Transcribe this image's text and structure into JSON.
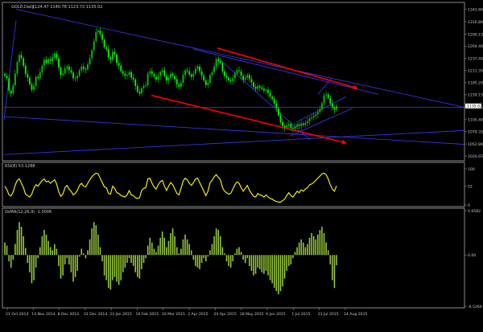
{
  "colors": {
    "background": "#000000",
    "frame": "#8a8a8a",
    "text": "#c8c8c8",
    "bull_candle": "#00cc00",
    "bear_candle": "#00ff00",
    "channel_lines": "#ff0000",
    "trend_lines": "#3a3aff",
    "rsi_line": "#ffff00",
    "osma_bars": "#9acd32",
    "price_line": "#b0b0b0"
  },
  "chart_data": [
    {
      "type": "candlestick",
      "title": "GOLD,Daily",
      "ohlc_text": "1124.47 1140.78 1123.72 1135.02",
      "y_ticks": [
        "1343.80",
        "1316.80",
        "1290.15",
        "1264.40",
        "1237.40",
        "1211.35",
        "1185.20",
        "1159.15",
        "1132.75",
        "1105.40",
        "1079.35",
        "1052.80",
        "1026.65"
      ],
      "ylim": [
        1020,
        1350
      ],
      "last_price": 1135.02,
      "closes": [
        1200,
        1195,
        1168,
        1162,
        1180,
        1205,
        1230,
        1245,
        1238,
        1222,
        1204,
        1196,
        1182,
        1170,
        1178,
        1198,
        1195,
        1208,
        1222,
        1235,
        1228,
        1236,
        1232,
        1240,
        1248,
        1238,
        1218,
        1202,
        1205,
        1216,
        1220,
        1212,
        1207,
        1195,
        1195,
        1200,
        1212,
        1220,
        1215,
        1214,
        1225,
        1238,
        1255,
        1275,
        1295,
        1298,
        1290,
        1278,
        1262,
        1258,
        1240,
        1235,
        1252,
        1246,
        1228,
        1222,
        1210,
        1205,
        1200,
        1202,
        1208,
        1196,
        1192,
        1178,
        1166,
        1162,
        1173,
        1178,
        1180,
        1205,
        1210,
        1204,
        1198,
        1192,
        1200,
        1208,
        1212,
        1200,
        1190,
        1196,
        1204,
        1200,
        1193,
        1182,
        1176,
        1185,
        1202,
        1212,
        1210,
        1203,
        1198,
        1205,
        1215,
        1220,
        1210,
        1201,
        1190,
        1180,
        1185,
        1202,
        1208,
        1220,
        1236,
        1232,
        1228,
        1210,
        1200,
        1196,
        1190,
        1188,
        1195,
        1205,
        1212,
        1210,
        1200,
        1192,
        1196,
        1202,
        1193,
        1186,
        1176,
        1172,
        1178,
        1175,
        1172,
        1168,
        1170,
        1163,
        1155,
        1150,
        1140,
        1130,
        1115,
        1100,
        1092,
        1088,
        1093,
        1096,
        1088,
        1086,
        1090,
        1095,
        1092,
        1097,
        1094,
        1098,
        1102,
        1108,
        1110,
        1113,
        1117,
        1122,
        1128,
        1141,
        1158,
        1160,
        1152,
        1140,
        1132,
        1127,
        1135
      ]
    },
    {
      "type": "line",
      "title": "RSI(8) 53.1288",
      "y_ticks": [
        "100",
        "52",
        "0"
      ],
      "ylim": [
        0,
        100
      ],
      "values": [
        52,
        42,
        28,
        25,
        36,
        55,
        68,
        72,
        60,
        48,
        30,
        26,
        22,
        30,
        46,
        56,
        52,
        60,
        68,
        72,
        64,
        66,
        60,
        65,
        70,
        58,
        36,
        24,
        30,
        48,
        54,
        44,
        38,
        28,
        32,
        40,
        54,
        60,
        52,
        50,
        60,
        70,
        78,
        84,
        88,
        86,
        74,
        62,
        50,
        48,
        32,
        30,
        52,
        46,
        34,
        32,
        26,
        24,
        22,
        28,
        40,
        28,
        26,
        20,
        18,
        20,
        40,
        46,
        48,
        72,
        74,
        60,
        50,
        44,
        56,
        64,
        68,
        52,
        40,
        52,
        62,
        56,
        44,
        32,
        28,
        46,
        66,
        74,
        70,
        60,
        54,
        62,
        72,
        74,
        62,
        50,
        38,
        26,
        38,
        62,
        68,
        78,
        84,
        76,
        70,
        48,
        38,
        34,
        30,
        32,
        44,
        56,
        64,
        60,
        48,
        38,
        46,
        54,
        40,
        32,
        24,
        22,
        32,
        28,
        26,
        22,
        28,
        22,
        18,
        16,
        12,
        10,
        8,
        8,
        12,
        16,
        26,
        34,
        26,
        22,
        30,
        38,
        34,
        42,
        38,
        44,
        48,
        56,
        58,
        62,
        68,
        74,
        80,
        86,
        88,
        84,
        72,
        56,
        44,
        38,
        53
      ]
    },
    {
      "type": "bar",
      "title": "OsMA(12,26,9) -1.3006",
      "y_ticks": [
        "5.6582",
        "0.00",
        "-6.5269"
      ],
      "ylim": [
        -6.5269,
        5.6582
      ],
      "x_ticks": [
        "21 Oct 2014",
        "14 Nov 2014",
        "8 Dec 2014",
        "31 Dec 2014",
        "23 Jan 2015",
        "16 Feb 2015",
        "10 Mar 2015",
        "2 Apr 2015",
        "24 Apr 2015",
        "18 May 2015",
        "9 Jun 2015",
        "1 Jul 2015",
        "23 Jul 2015",
        "14 Aug 2015"
      ],
      "values": [
        1.6,
        1.2,
        -0.8,
        -1.6,
        -0.6,
        1.4,
        3.2,
        4.2,
        3.6,
        2.4,
        0.9,
        -1.0,
        -2.2,
        -3.6,
        -3.2,
        -1.6,
        -0.4,
        1.0,
        2.4,
        3.2,
        2.6,
        1.8,
        1.0,
        0.6,
        1.4,
        0.8,
        -1.4,
        -3.0,
        -2.6,
        -1.2,
        -0.4,
        -1.2,
        -2.2,
        -3.4,
        -2.8,
        -2.0,
        -0.2,
        0.8,
        0.2,
        -0.4,
        0.6,
        2.0,
        3.4,
        4.2,
        3.8,
        2.6,
        1.0,
        -0.8,
        -2.6,
        -3.2,
        -4.2,
        -4.4,
        -3.2,
        -2.8,
        -3.4,
        -3.8,
        -3.2,
        -2.2,
        -1.6,
        -1.0,
        -0.4,
        -1.0,
        -1.4,
        -2.2,
        -2.8,
        -3.0,
        -1.8,
        -1.0,
        -0.4,
        1.2,
        2.2,
        1.6,
        0.8,
        0.4,
        1.2,
        2.2,
        3.0,
        2.2,
        1.0,
        1.8,
        2.8,
        3.4,
        2.4,
        1.0,
        0.2,
        0.8,
        2.0,
        2.6,
        2.0,
        1.4,
        0.6,
        -0.6,
        -1.4,
        -1.6,
        -1.8,
        -1.0,
        -0.4,
        -0.8,
        -0.2,
        0.6,
        1.4,
        2.4,
        3.4,
        3.2,
        2.4,
        1.0,
        0.2,
        -0.8,
        -1.4,
        -1.6,
        -0.8,
        0.2,
        0.8,
        1.0,
        0.4,
        -0.6,
        -1.0,
        -0.4,
        -1.4,
        -2.0,
        -2.6,
        -2.4,
        -1.6,
        -1.8,
        -2.2,
        -2.4,
        -2.0,
        -2.6,
        -3.2,
        -3.6,
        -4.2,
        -4.6,
        -5.0,
        -4.6,
        -4.0,
        -3.0,
        -2.0,
        -1.4,
        -1.2,
        -0.4,
        0.4,
        1.0,
        1.6,
        2.0,
        1.6,
        1.0,
        1.4,
        2.2,
        2.8,
        2.4,
        2.0,
        2.6,
        3.2,
        3.6,
        2.8,
        1.6,
        0.6,
        -1.2,
        -3.2,
        -4.2,
        -1.3
      ]
    }
  ]
}
